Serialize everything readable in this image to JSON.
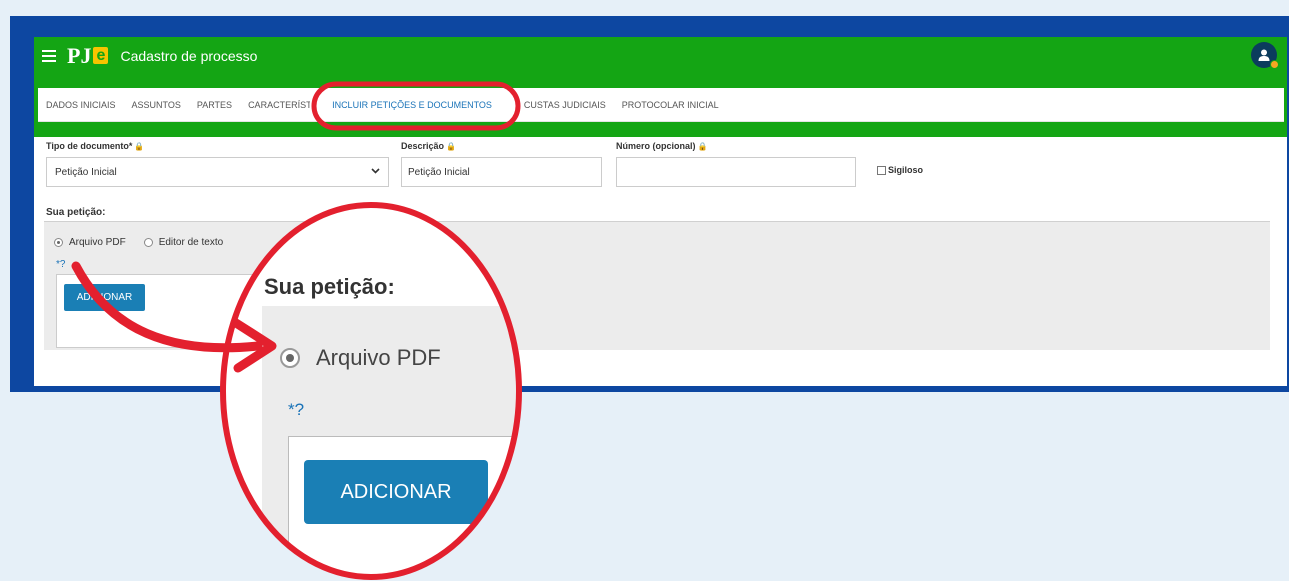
{
  "header": {
    "logo_text": "PJ",
    "logo_accent": "e",
    "title": "Cadastro de processo",
    "brand_color": "#14a514",
    "menu_icon": "hamburger-menu-icon",
    "avatar_icon": "user-avatar-icon"
  },
  "tabs": [
    {
      "label": "DADOS INICIAIS"
    },
    {
      "label": "ASSUNTOS"
    },
    {
      "label": "PARTES"
    },
    {
      "label": "CARACTERÍSTICAS"
    },
    {
      "label": "INCLUIR PETIÇÕES E DOCUMENTOS",
      "active": true
    },
    {
      "label": "CUSTAS JUDICIAIS"
    },
    {
      "label": "PROTOCOLAR INICIAL"
    }
  ],
  "form": {
    "tipo_label": "Tipo de documento*",
    "tipo_value": "Petição Inicial",
    "descricao_label": "Descrição",
    "descricao_value": "Petição Inicial",
    "numero_label": "Número (opcional)",
    "numero_value": "",
    "sigiloso_label": "Sigiloso",
    "lock_glyph": "🔒"
  },
  "peticao": {
    "section_label": "Sua petição:",
    "option_pdf": "Arquivo PDF",
    "option_editor": "Editor de texto",
    "required_mark": "*",
    "help_glyph": "?",
    "add_button": "ADICIONAR"
  },
  "zoom": {
    "title": "Sua petição:",
    "option_pdf": "Arquivo PDF",
    "required_mark": "*",
    "help_glyph": "?",
    "add_button": "ADICIONAR"
  },
  "annotation_color": "#e3202e"
}
